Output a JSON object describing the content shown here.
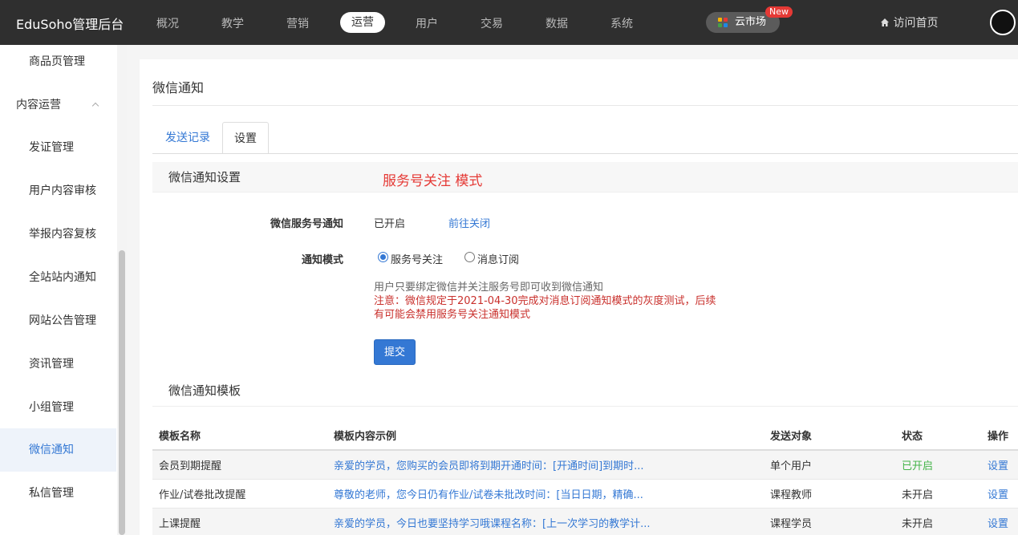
{
  "header": {
    "brand": "EduSoho管理后台",
    "nav": [
      "概况",
      "教学",
      "营销",
      "运营",
      "用户",
      "交易",
      "数据",
      "系统"
    ],
    "active_nav": "运营",
    "cloud_market": "云市场",
    "new_badge": "New",
    "home_link": "访问首页",
    "colors": {
      "bar": "#2f2f2f",
      "accent": "#3478d4"
    }
  },
  "sidebar": {
    "items": [
      "商品页管理",
      "内容运营",
      "发证管理",
      "用户内容审核",
      "举报内容复核",
      "全站站内通知",
      "网站公告管理",
      "资讯管理",
      "小组管理",
      "微信通知",
      "私信管理"
    ],
    "active": "微信通知"
  },
  "main": {
    "title": "微信通知",
    "tabs": [
      "发送记录",
      "设置"
    ],
    "active_tab": "设置",
    "settings_section": "微信通知设置",
    "annotation": "服务号关注 模式",
    "service_label": "微信服务号通知",
    "service_status": "已开启",
    "service_action": "前往关闭",
    "mode_label": "通知模式",
    "mode_options": [
      "服务号关注",
      "消息订阅"
    ],
    "mode_selected": "服务号关注",
    "help": "用户只要绑定微信并关注服务号即可收到微信通知",
    "warning_1": "注意：微信规定于2021-04-30完成对消息订阅通知模式的灰度测试，后续",
    "warning_2": "有可能会禁用服务号关注通知模式",
    "submit": "提交",
    "template_section": "微信通知模板"
  },
  "table": {
    "headers": [
      "模板名称",
      "模板内容示例",
      "发送对象",
      "状态",
      "操作"
    ],
    "rows": [
      {
        "name": "会员到期提醒",
        "example": "亲爱的学员，您购买的会员即将到期开通时间：[开通时间]到期时...",
        "target": "单个用户",
        "status": "已开启",
        "action": "设置"
      },
      {
        "name": "作业/试卷批改提醒",
        "example": "尊敬的老师，您今日仍有作业/试卷未批改时间：[当日日期，精确...",
        "target": "课程教师",
        "status": "未开启",
        "action": "设置"
      },
      {
        "name": "上课提醒",
        "example": "亲爱的学员，今日也要坚持学习哦课程名称：[上一次学习的教学计...",
        "target": "课程学员",
        "status": "未开启",
        "action": "设置"
      }
    ]
  }
}
